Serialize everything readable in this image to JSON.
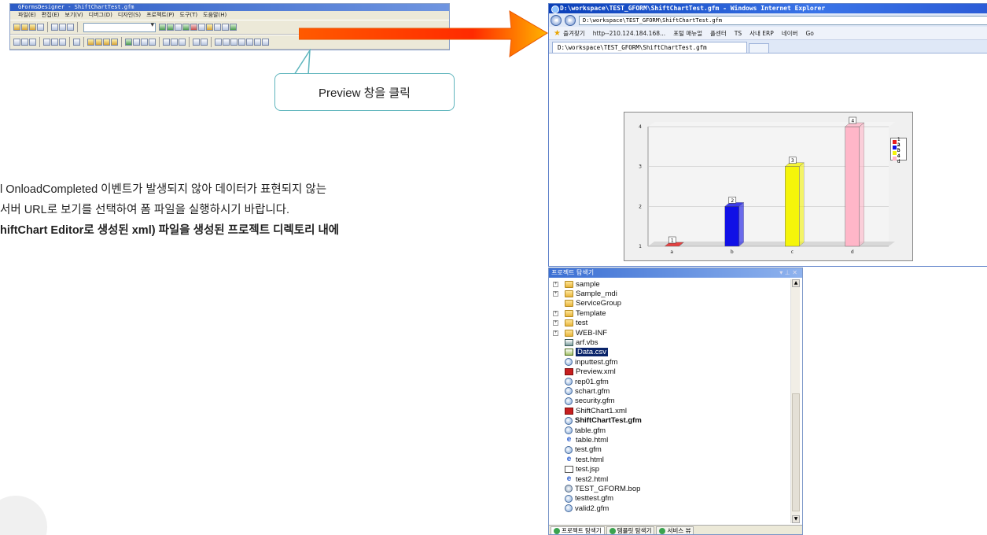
{
  "designer": {
    "title": "GFormsDesigner - ShiftChartTest.gfm",
    "menu": [
      "파일(E)",
      "편집(E)",
      "보기(V)",
      "디버그(D)",
      "디자인(S)",
      "프로젝트(P)",
      "도구(T)",
      "도움말(H)"
    ]
  },
  "callout": {
    "text": "Preview 창을 클릭"
  },
  "notes": {
    "line1": "l OnloadCompleted 이벤트가 발생되지 않아 데이터가 표현되지 않는",
    "line2": "서버 URL로 보기를 선택하여 폼 파일을 실행하시기 바랍니다.",
    "line3": "hiftChart Editor로 생성된 xml) 파일을 생성된 프로젝트 디렉토리 내에"
  },
  "browser": {
    "title": "D:\\workspace\\TEST_GFORM\\ShiftChartTest.gfm - Windows Internet Explorer",
    "address": "D:\\workspace\\TEST_GFORM\\ShiftChartTest.gfm",
    "favorites": [
      "즐겨찾기",
      "http--210.124.184.168...",
      "포털 매뉴얼",
      "플센터",
      "TS",
      "사내 ERP",
      "네이버",
      "Go"
    ],
    "tab": "D:\\workspace\\TEST_GFORM\\ShiftChartTest.gfm"
  },
  "chart_data": {
    "type": "bar",
    "categories": [
      "a",
      "b",
      "c",
      "d"
    ],
    "values": [
      1,
      2,
      3,
      4
    ],
    "data_labels": [
      "1",
      "2",
      "3",
      "4"
    ],
    "ylim": [
      1,
      4
    ],
    "y_ticks": [
      "1",
      "2",
      "3",
      "4"
    ],
    "colors": [
      "#e81d1d",
      "#1010e6",
      "#f5f50a",
      "#ffb6c8"
    ],
    "legend": [
      "1 a",
      "2 b",
      "3 c",
      "4 d"
    ],
    "legend_position": "right",
    "grid": true,
    "style": "3d"
  },
  "explorer": {
    "title": "프로젝트 탐색기",
    "items": [
      {
        "label": "sample",
        "icon": "folder",
        "exp": "+"
      },
      {
        "label": "Sample_mdi",
        "icon": "folder",
        "exp": "+"
      },
      {
        "label": "ServiceGroup",
        "icon": "folder",
        "exp": ""
      },
      {
        "label": "Template",
        "icon": "folder",
        "exp": "+"
      },
      {
        "label": "test",
        "icon": "folder",
        "exp": "+"
      },
      {
        "label": "WEB-INF",
        "icon": "folder",
        "exp": "+"
      },
      {
        "label": "arf.vbs",
        "icon": "fvbs",
        "exp": ""
      },
      {
        "label": "Data.csv",
        "icon": "fcsv",
        "exp": "",
        "selected": true
      },
      {
        "label": "inputtest.gfm",
        "icon": "fgfm",
        "exp": ""
      },
      {
        "label": "Preview.xml",
        "icon": "fxml",
        "exp": ""
      },
      {
        "label": "rep01.gfm",
        "icon": "fgfm",
        "exp": ""
      },
      {
        "label": "schart.gfm",
        "icon": "fgfm",
        "exp": ""
      },
      {
        "label": "security.gfm",
        "icon": "fgfm",
        "exp": ""
      },
      {
        "label": "ShiftChart1.xml",
        "icon": "fxml",
        "exp": ""
      },
      {
        "label": "ShiftChartTest.gfm",
        "icon": "fgfm",
        "exp": "",
        "bold": true
      },
      {
        "label": "table.gfm",
        "icon": "fgfm",
        "exp": ""
      },
      {
        "label": "table.html",
        "icon": "fhtml",
        "exp": ""
      },
      {
        "label": "test.gfm",
        "icon": "fgfm",
        "exp": ""
      },
      {
        "label": "test.html",
        "icon": "fhtml",
        "exp": ""
      },
      {
        "label": "test.jsp",
        "icon": "fjsp",
        "exp": ""
      },
      {
        "label": "test2.html",
        "icon": "fhtml",
        "exp": ""
      },
      {
        "label": "TEST_GFORM.bop",
        "icon": "fbop",
        "exp": ""
      },
      {
        "label": "testtest.gfm",
        "icon": "fgfm",
        "exp": ""
      },
      {
        "label": "valid2.gfm",
        "icon": "fgfm",
        "exp": ""
      }
    ],
    "bottom_tabs": [
      "프로젝트 탐색기",
      "템플릿 탐색기",
      "서비스 뷰"
    ]
  }
}
